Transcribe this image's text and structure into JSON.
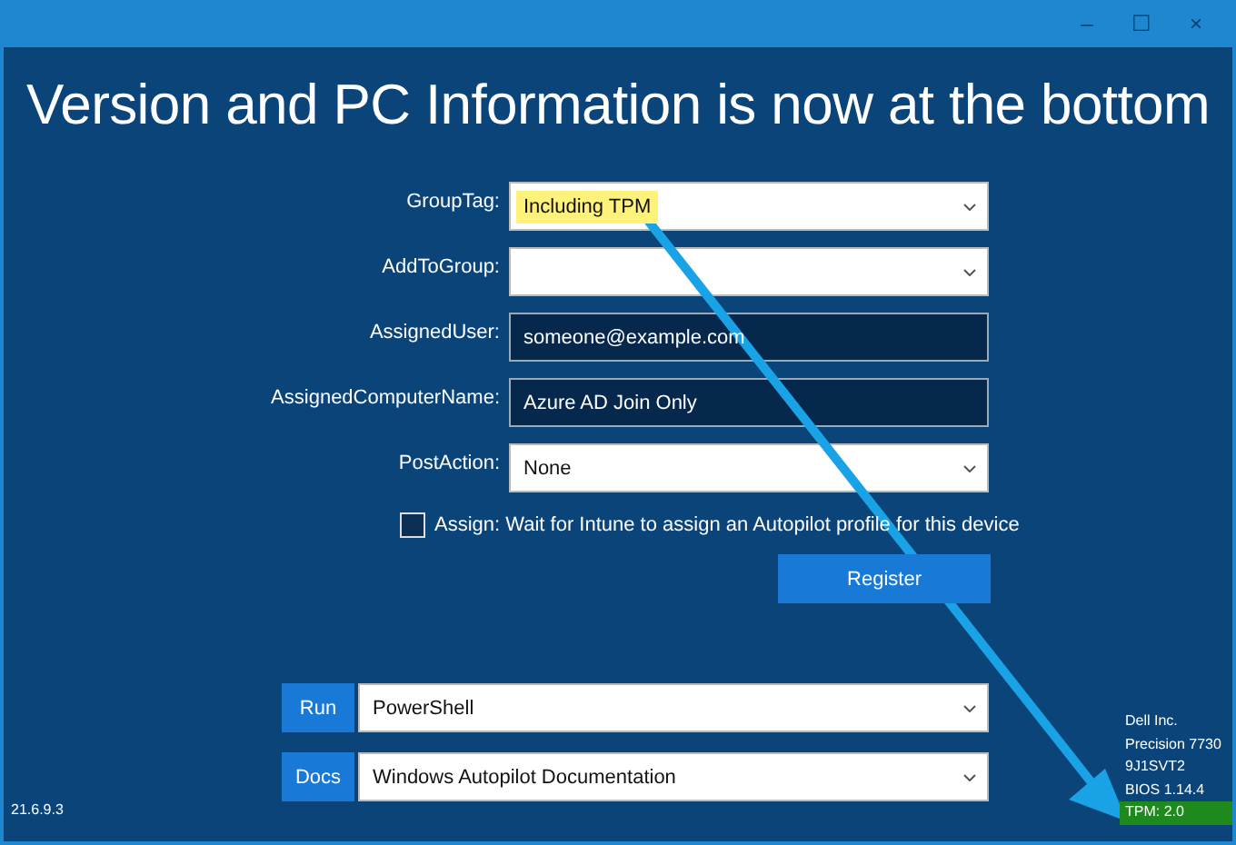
{
  "window": {
    "title_bar_buttons": [
      "–",
      "☐",
      "×"
    ]
  },
  "heading": "Version and PC Information is now at the bottom",
  "form": [
    {
      "kind": "dropdown",
      "label": "GroupTag:",
      "value": "Including TPM",
      "highlighted": true
    },
    {
      "kind": "dropdown",
      "label": "AddToGroup:"
    },
    {
      "kind": "text",
      "label": "AssignedUser:",
      "value": "someone@example.com"
    },
    {
      "kind": "text",
      "label": "AssignedComputerName:",
      "value": "Azure AD Join Only"
    },
    {
      "kind": "dropdown",
      "label": "PostAction:",
      "value": "None"
    }
  ],
  "assign": {
    "label": "Assign: Wait for Intune to assign an Autopilot profile for this device",
    "checked": false
  },
  "register_button": "Register",
  "tools": [
    {
      "button": "Run",
      "value": "PowerShell"
    },
    {
      "button": "Docs",
      "value": "Windows Autopilot Documentation"
    }
  ],
  "version": "21.6.9.3",
  "device_info": [
    {
      "text": "Dell Inc.",
      "highlighted": false
    },
    {
      "text": "Precision 7730",
      "highlighted": false
    },
    {
      "text": "9J1SVT2",
      "highlighted": false
    },
    {
      "text": "BIOS 1.14.4",
      "highlighted": false
    },
    {
      "text": "TPM: 2.0",
      "highlighted": true
    }
  ]
}
